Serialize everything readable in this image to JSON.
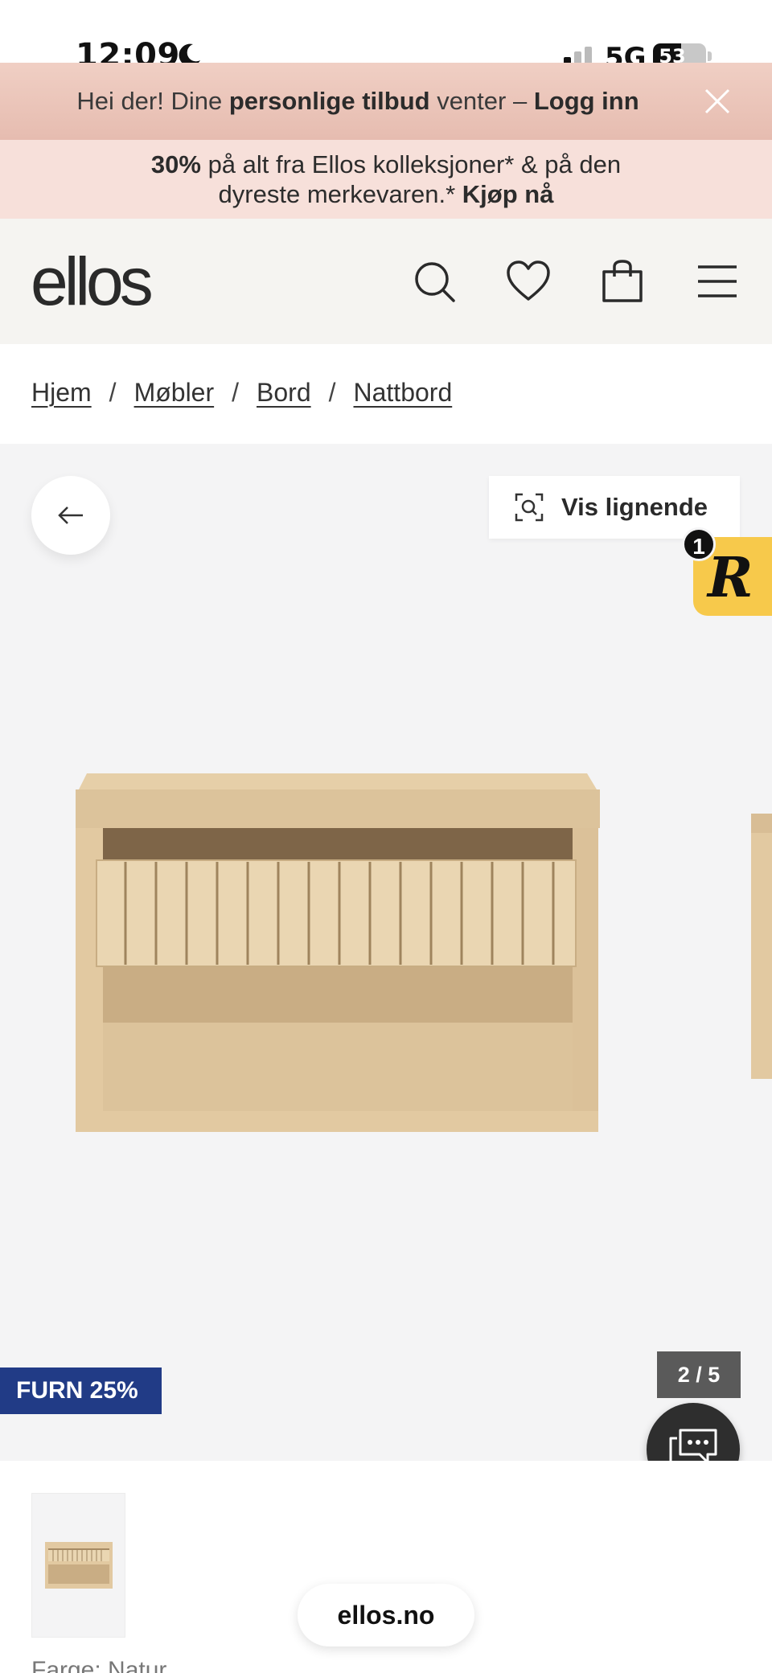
{
  "status_bar": {
    "time": "12:09",
    "network": "5G",
    "battery_level": "53",
    "battery_percent": 53
  },
  "login_banner": {
    "prefix": "Hei der! Dine ",
    "highlight": "personlige tilbud",
    "middle": " venter – ",
    "login_link": "Logg inn"
  },
  "promo_banner": {
    "percent": "30%",
    "text": " på alt fra Ellos kolleksjoner* & på den dyreste merkevaren.* ",
    "cta": "Kjøp nå"
  },
  "header": {
    "logo": "ellos",
    "icons": [
      "search-icon",
      "heart-icon",
      "bag-icon",
      "menu-icon"
    ]
  },
  "breadcrumb": {
    "items": [
      "Hjem",
      "Møbler",
      "Bord",
      "Nattbord"
    ],
    "separator": "/"
  },
  "gallery": {
    "similar_label": "Vis lignende",
    "badge_count": "1",
    "promo_tag": "FURN 25%",
    "pager": "2 / 5",
    "current_image": 2,
    "total_images": 5
  },
  "product": {
    "color_label": "Farge: Natur"
  },
  "browser": {
    "url": "ellos.no"
  },
  "colors": {
    "login_banner_bg": "#e9c3b8",
    "promo_banner_bg": "#f7e0da",
    "header_bg": "#f5f4f1",
    "promo_tag_bg": "#213b86",
    "badge_bg": "#f7c94b"
  }
}
